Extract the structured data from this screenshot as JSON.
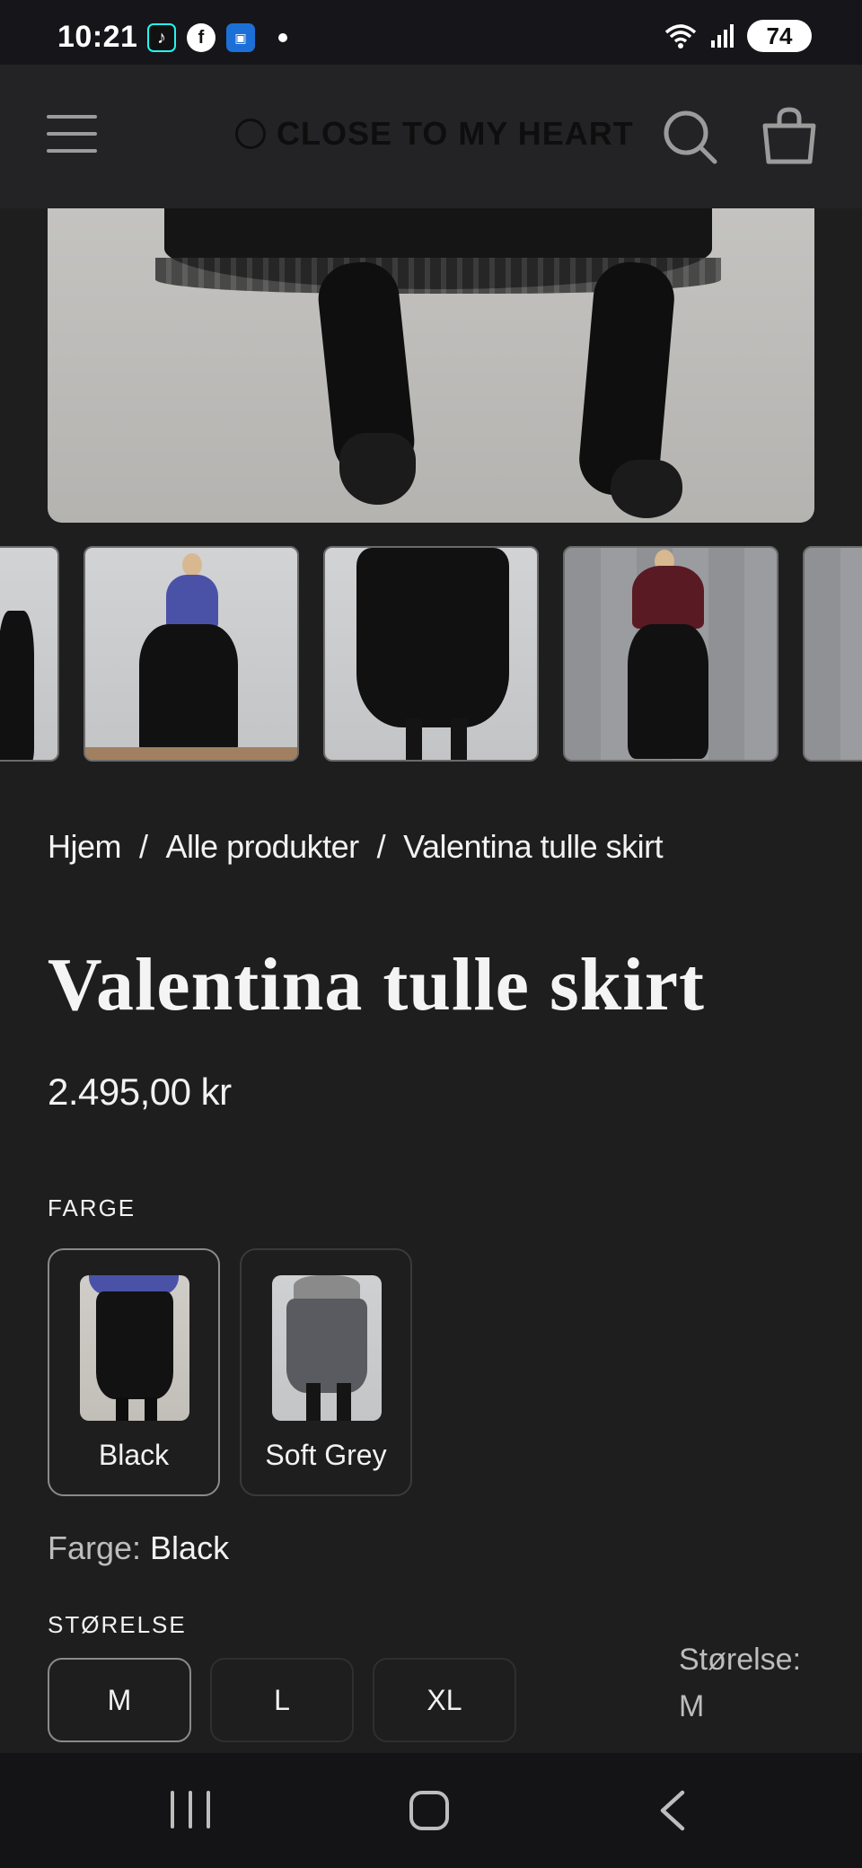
{
  "status_bar": {
    "time": "10:21",
    "app_icons": [
      "tiktok-icon",
      "facebook-icon",
      "news-app-icon"
    ],
    "battery": "74"
  },
  "header": {
    "brand": "CLOSE TO MY HEART",
    "icons": [
      "menu-icon",
      "search-icon",
      "shopping-bag-icon"
    ]
  },
  "breadcrumb": {
    "items": [
      "Hjem",
      "Alle produkter",
      "Valentina tulle skirt"
    ],
    "separator": "/"
  },
  "product": {
    "title": "Valentina tulle skirt",
    "price": "2.495,00 kr"
  },
  "color": {
    "section_label": "FARGE",
    "options": [
      "Black",
      "Soft Grey"
    ],
    "selected_label": "Farge:",
    "selected_value": "Black"
  },
  "size": {
    "section_label": "STØRELSE",
    "options": [
      "M",
      "L",
      "XL"
    ],
    "selected_label": "Størelse:",
    "selected_value": "M"
  },
  "colors": {
    "background": "#1e1e1f",
    "header": "#232325",
    "text": "#f2f2f2",
    "muted_text": "#bdbdbd",
    "selected_border": "#8a8a8a"
  }
}
